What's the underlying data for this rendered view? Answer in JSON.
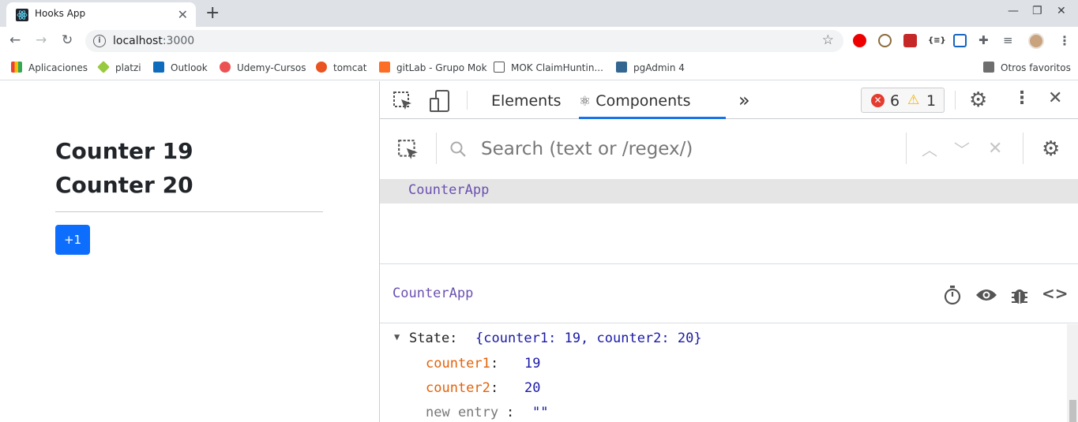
{
  "browser": {
    "tab_title": "Hooks App",
    "tab_close": "✕",
    "new_tab": "+",
    "url_host": "localhost",
    "url_port": ":3000",
    "win_minimize": "—",
    "win_restore": "❐",
    "win_close": "✕"
  },
  "bookmarks": [
    {
      "label": "Aplicaciones",
      "color": "#4285f4"
    },
    {
      "label": "platzi",
      "color": "#98ca3f"
    },
    {
      "label": "Outlook",
      "color": "#0f6cbd"
    },
    {
      "label": "Udemy-Cursos",
      "color": "#ec5252"
    },
    {
      "label": "tomcat",
      "color": "#e95420"
    },
    {
      "label": "gitLab - Grupo Mok",
      "color": "#fc6d26"
    },
    {
      "label": "MOK ClaimHuntin...",
      "color": "#555555"
    },
    {
      "label": "pgAdmin 4",
      "color": "#336791"
    }
  ],
  "other_bookmarks": "Otros favoritos",
  "app": {
    "counter1_heading": "Counter 19",
    "counter2_heading": "Counter 20",
    "increment_button": "+1"
  },
  "devtools": {
    "tab_elements": "Elements",
    "tab_components": "Components",
    "more_tabs": "»",
    "error_count": "6",
    "warning_count": "1",
    "search_placeholder": "Search (text or /regex/)",
    "tree_selected": "CounterApp",
    "inspected_component": "CounterApp",
    "state_label": "State:",
    "state_summary": "{counter1: 19, counter2: 20}",
    "props": [
      {
        "key": "counter1",
        "value": "19"
      },
      {
        "key": "counter2",
        "value": "20"
      },
      {
        "key": "new entry",
        "value": "\"\""
      }
    ]
  },
  "colors": {
    "accent": "#1a73e8",
    "component_name": "#6b50b0",
    "prop_key": "#e36209",
    "prop_value": "#1a1aa6",
    "button_primary": "#0d6efd"
  }
}
